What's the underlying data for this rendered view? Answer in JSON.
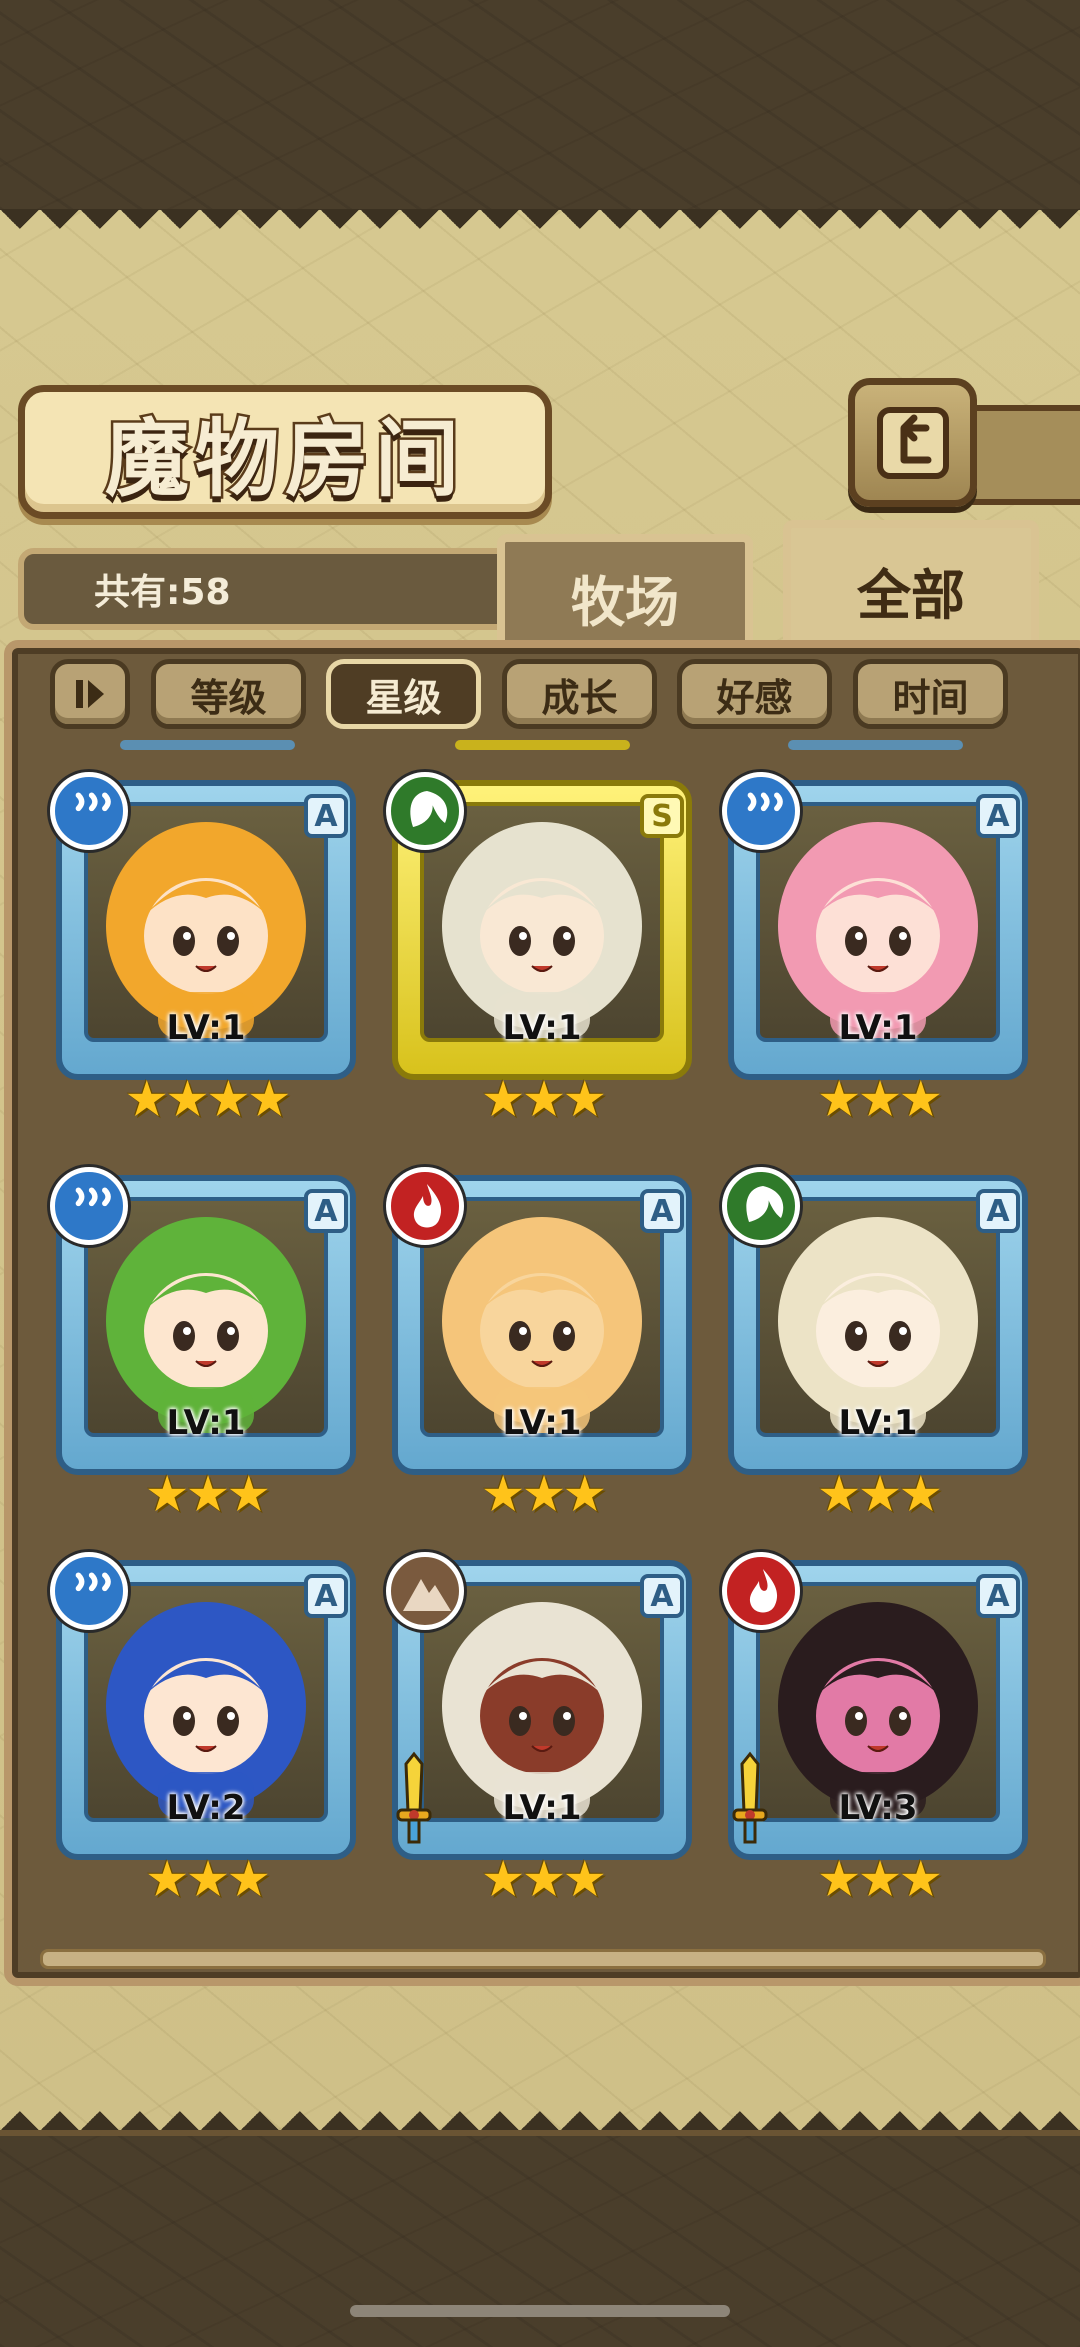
{
  "title": "魔物房间",
  "count": {
    "label": "共有:58"
  },
  "tabs": [
    {
      "label": "牧场",
      "active": false
    },
    {
      "label": "全部",
      "active": true
    }
  ],
  "sort_buttons": [
    {
      "label": "等级",
      "active": false
    },
    {
      "label": "星级",
      "active": true
    },
    {
      "label": "成长",
      "active": false
    },
    {
      "label": "好感",
      "active": false
    },
    {
      "label": "时间",
      "active": false
    }
  ],
  "monsters": [
    {
      "level": "LV:1",
      "rank": "A",
      "element": "water",
      "stars": "★★★★",
      "frame": "blue",
      "hair": "#f2a72c",
      "skin": "#fde2c6",
      "weapon": false
    },
    {
      "level": "LV:1",
      "rank": "S",
      "element": "nature",
      "stars": "★★★",
      "frame": "gold",
      "hair": "#e6e2cf",
      "skin": "#f9e8d4",
      "weapon": false
    },
    {
      "level": "LV:1",
      "rank": "A",
      "element": "water",
      "stars": "★★★",
      "frame": "blue",
      "hair": "#f29ab2",
      "skin": "#fde0d6",
      "weapon": false
    },
    {
      "level": "LV:1",
      "rank": "A",
      "element": "water",
      "stars": "★★★",
      "frame": "blue",
      "hair": "#5fb33a",
      "skin": "#fde6cf",
      "weapon": false
    },
    {
      "level": "LV:1",
      "rank": "A",
      "element": "fire",
      "stars": "★★★",
      "frame": "blue",
      "hair": "#f5c57a",
      "skin": "#f8d59c",
      "weapon": false
    },
    {
      "level": "LV:1",
      "rank": "A",
      "element": "nature",
      "stars": "★★★",
      "frame": "blue",
      "hair": "#ece3c6",
      "skin": "#fbeede",
      "weapon": false
    },
    {
      "level": "LV:2",
      "rank": "A",
      "element": "water",
      "stars": "★★★",
      "frame": "blue",
      "hair": "#2d57c4",
      "skin": "#fde6d2",
      "weapon": false
    },
    {
      "level": "LV:1",
      "rank": "A",
      "element": "earth",
      "stars": "★★★",
      "frame": "blue",
      "hair": "#e9e3d3",
      "skin": "#8a3c2a",
      "weapon": true
    },
    {
      "level": "LV:3",
      "rank": "A",
      "element": "fire",
      "stars": "★★★",
      "frame": "blue",
      "hair": "#2a1c1e",
      "skin": "#e27aa6",
      "weapon": true
    }
  ],
  "colors": {
    "accent_gold": "#ffc31a",
    "frame_blue": "#64a8cf",
    "frame_gold": "#d8c21c"
  }
}
